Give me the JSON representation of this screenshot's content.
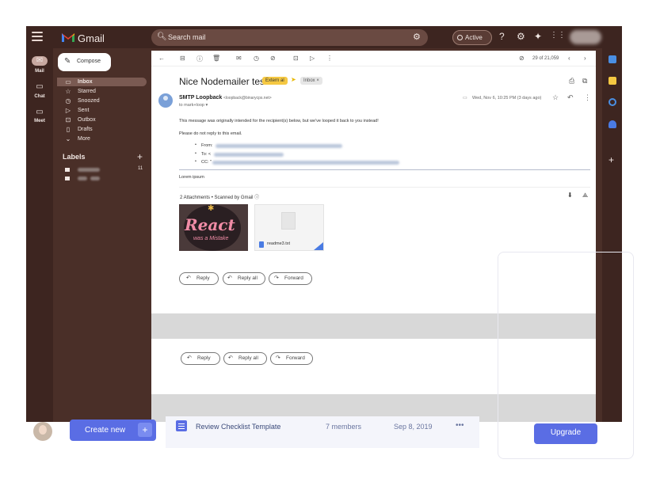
{
  "app": {
    "name": "Gmail",
    "search_placeholder": "Search mail",
    "status": "Active"
  },
  "rail": {
    "mail": "Mail",
    "chat": "Chat",
    "meet": "Meet"
  },
  "nav": {
    "compose": "Compose",
    "items": [
      "Inbox",
      "Starred",
      "Snoozed",
      "Sent",
      "Outbox",
      "Drafts",
      "More"
    ],
    "labels_heading": "Labels",
    "label_count": "11"
  },
  "toolbar": {
    "count": "29 of 21,059"
  },
  "email": {
    "subject": "Nice Nodemailer test",
    "external_badge": "Extern al",
    "inbox_badge": "Inbox ×",
    "sender_name": "SMTP Loopback",
    "sender_email": "<loopback@binarycps.net>",
    "to_line": "to mark+loop ▾",
    "date": "Wed, Nov 6, 10:25 PM (3 days ago)",
    "line1": "This message was originally intended for the recipient(s) below, but we've looped it back to you instead!",
    "line2": "Please do not reply to this email.",
    "bullet_from": "From:",
    "bullet_to": "To: <",
    "bullet_cc": "CC: \"",
    "lorem": "Lorem ipsum",
    "attachments_header": "2 Attachments  •  Scanned by Gmail ⓘ",
    "image_text_1": "React",
    "image_text_2": "was a Mistake",
    "file_name": "readme3.txt"
  },
  "actions": {
    "reply": "Reply",
    "reply_all": "Reply all",
    "forward": "Forward"
  },
  "bottom": {
    "create_new": "Create new",
    "create_plus": "+",
    "doc_title": "Review Checklist Template",
    "members": "7 members",
    "date": "Sep 8, 2019",
    "more": "•••",
    "upgrade": "Upgrade"
  },
  "colors": {
    "frame": "#4a2f28",
    "accent": "#5a6de4",
    "external_badge": "#f5c842"
  }
}
